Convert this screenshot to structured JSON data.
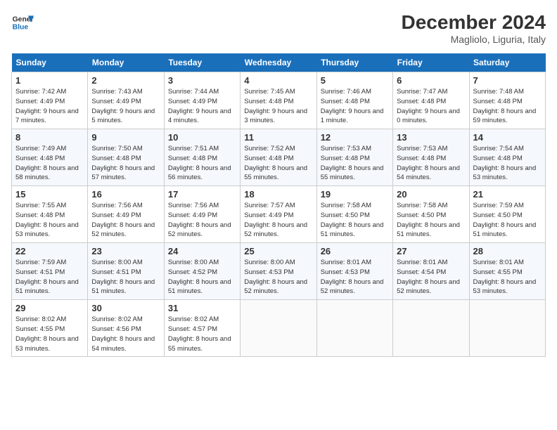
{
  "header": {
    "logo_line1": "General",
    "logo_line2": "Blue",
    "month": "December 2024",
    "location": "Magliolo, Liguria, Italy"
  },
  "weekdays": [
    "Sunday",
    "Monday",
    "Tuesday",
    "Wednesday",
    "Thursday",
    "Friday",
    "Saturday"
  ],
  "weeks": [
    [
      {
        "day": "1",
        "sunrise": "Sunrise: 7:42 AM",
        "sunset": "Sunset: 4:49 PM",
        "daylight": "Daylight: 9 hours and 7 minutes."
      },
      {
        "day": "2",
        "sunrise": "Sunrise: 7:43 AM",
        "sunset": "Sunset: 4:49 PM",
        "daylight": "Daylight: 9 hours and 5 minutes."
      },
      {
        "day": "3",
        "sunrise": "Sunrise: 7:44 AM",
        "sunset": "Sunset: 4:49 PM",
        "daylight": "Daylight: 9 hours and 4 minutes."
      },
      {
        "day": "4",
        "sunrise": "Sunrise: 7:45 AM",
        "sunset": "Sunset: 4:48 PM",
        "daylight": "Daylight: 9 hours and 3 minutes."
      },
      {
        "day": "5",
        "sunrise": "Sunrise: 7:46 AM",
        "sunset": "Sunset: 4:48 PM",
        "daylight": "Daylight: 9 hours and 1 minute."
      },
      {
        "day": "6",
        "sunrise": "Sunrise: 7:47 AM",
        "sunset": "Sunset: 4:48 PM",
        "daylight": "Daylight: 9 hours and 0 minutes."
      },
      {
        "day": "7",
        "sunrise": "Sunrise: 7:48 AM",
        "sunset": "Sunset: 4:48 PM",
        "daylight": "Daylight: 8 hours and 59 minutes."
      }
    ],
    [
      {
        "day": "8",
        "sunrise": "Sunrise: 7:49 AM",
        "sunset": "Sunset: 4:48 PM",
        "daylight": "Daylight: 8 hours and 58 minutes."
      },
      {
        "day": "9",
        "sunrise": "Sunrise: 7:50 AM",
        "sunset": "Sunset: 4:48 PM",
        "daylight": "Daylight: 8 hours and 57 minutes."
      },
      {
        "day": "10",
        "sunrise": "Sunrise: 7:51 AM",
        "sunset": "Sunset: 4:48 PM",
        "daylight": "Daylight: 8 hours and 56 minutes."
      },
      {
        "day": "11",
        "sunrise": "Sunrise: 7:52 AM",
        "sunset": "Sunset: 4:48 PM",
        "daylight": "Daylight: 8 hours and 55 minutes."
      },
      {
        "day": "12",
        "sunrise": "Sunrise: 7:53 AM",
        "sunset": "Sunset: 4:48 PM",
        "daylight": "Daylight: 8 hours and 55 minutes."
      },
      {
        "day": "13",
        "sunrise": "Sunrise: 7:53 AM",
        "sunset": "Sunset: 4:48 PM",
        "daylight": "Daylight: 8 hours and 54 minutes."
      },
      {
        "day": "14",
        "sunrise": "Sunrise: 7:54 AM",
        "sunset": "Sunset: 4:48 PM",
        "daylight": "Daylight: 8 hours and 53 minutes."
      }
    ],
    [
      {
        "day": "15",
        "sunrise": "Sunrise: 7:55 AM",
        "sunset": "Sunset: 4:48 PM",
        "daylight": "Daylight: 8 hours and 53 minutes."
      },
      {
        "day": "16",
        "sunrise": "Sunrise: 7:56 AM",
        "sunset": "Sunset: 4:49 PM",
        "daylight": "Daylight: 8 hours and 52 minutes."
      },
      {
        "day": "17",
        "sunrise": "Sunrise: 7:56 AM",
        "sunset": "Sunset: 4:49 PM",
        "daylight": "Daylight: 8 hours and 52 minutes."
      },
      {
        "day": "18",
        "sunrise": "Sunrise: 7:57 AM",
        "sunset": "Sunset: 4:49 PM",
        "daylight": "Daylight: 8 hours and 52 minutes."
      },
      {
        "day": "19",
        "sunrise": "Sunrise: 7:58 AM",
        "sunset": "Sunset: 4:50 PM",
        "daylight": "Daylight: 8 hours and 51 minutes."
      },
      {
        "day": "20",
        "sunrise": "Sunrise: 7:58 AM",
        "sunset": "Sunset: 4:50 PM",
        "daylight": "Daylight: 8 hours and 51 minutes."
      },
      {
        "day": "21",
        "sunrise": "Sunrise: 7:59 AM",
        "sunset": "Sunset: 4:50 PM",
        "daylight": "Daylight: 8 hours and 51 minutes."
      }
    ],
    [
      {
        "day": "22",
        "sunrise": "Sunrise: 7:59 AM",
        "sunset": "Sunset: 4:51 PM",
        "daylight": "Daylight: 8 hours and 51 minutes."
      },
      {
        "day": "23",
        "sunrise": "Sunrise: 8:00 AM",
        "sunset": "Sunset: 4:51 PM",
        "daylight": "Daylight: 8 hours and 51 minutes."
      },
      {
        "day": "24",
        "sunrise": "Sunrise: 8:00 AM",
        "sunset": "Sunset: 4:52 PM",
        "daylight": "Daylight: 8 hours and 51 minutes."
      },
      {
        "day": "25",
        "sunrise": "Sunrise: 8:00 AM",
        "sunset": "Sunset: 4:53 PM",
        "daylight": "Daylight: 8 hours and 52 minutes."
      },
      {
        "day": "26",
        "sunrise": "Sunrise: 8:01 AM",
        "sunset": "Sunset: 4:53 PM",
        "daylight": "Daylight: 8 hours and 52 minutes."
      },
      {
        "day": "27",
        "sunrise": "Sunrise: 8:01 AM",
        "sunset": "Sunset: 4:54 PM",
        "daylight": "Daylight: 8 hours and 52 minutes."
      },
      {
        "day": "28",
        "sunrise": "Sunrise: 8:01 AM",
        "sunset": "Sunset: 4:55 PM",
        "daylight": "Daylight: 8 hours and 53 minutes."
      }
    ],
    [
      {
        "day": "29",
        "sunrise": "Sunrise: 8:02 AM",
        "sunset": "Sunset: 4:55 PM",
        "daylight": "Daylight: 8 hours and 53 minutes."
      },
      {
        "day": "30",
        "sunrise": "Sunrise: 8:02 AM",
        "sunset": "Sunset: 4:56 PM",
        "daylight": "Daylight: 8 hours and 54 minutes."
      },
      {
        "day": "31",
        "sunrise": "Sunrise: 8:02 AM",
        "sunset": "Sunset: 4:57 PM",
        "daylight": "Daylight: 8 hours and 55 minutes."
      },
      null,
      null,
      null,
      null
    ]
  ]
}
